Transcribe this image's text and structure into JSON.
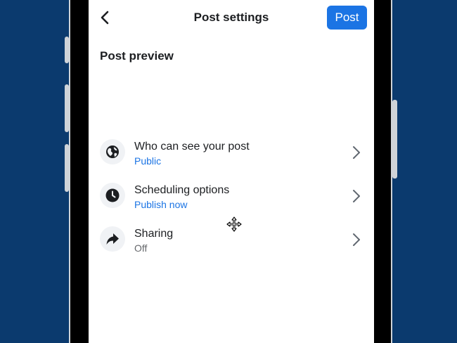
{
  "header": {
    "title": "Post settings",
    "post_label": "Post"
  },
  "preview": {
    "title": "Post preview"
  },
  "options": [
    {
      "label": "Who can see your post",
      "value": "Public",
      "icon": "globe-icon"
    },
    {
      "label": "Scheduling options",
      "value": "Publish now",
      "icon": "clock-icon"
    },
    {
      "label": "Sharing",
      "value": "Off",
      "icon": "share-arrow-icon"
    }
  ],
  "colors": {
    "background": "#0b3a6e",
    "accent": "#1b74e4",
    "secondary_text": "#65676b"
  }
}
